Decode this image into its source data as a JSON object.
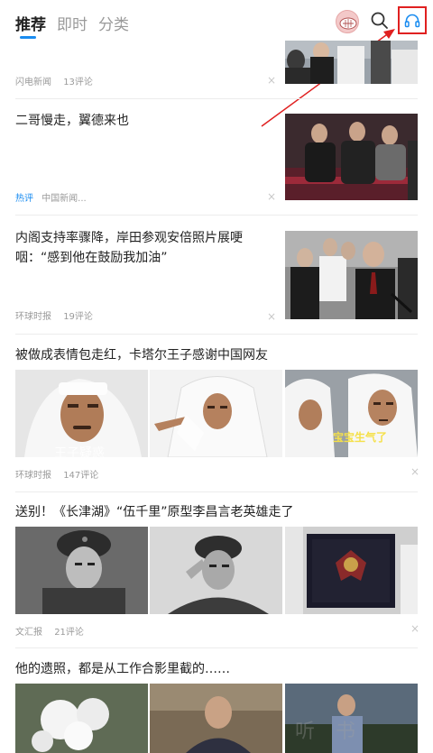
{
  "header": {
    "tabs": [
      {
        "label": "推荐",
        "active": true
      },
      {
        "label": "即时",
        "active": false
      },
      {
        "label": "分类",
        "active": false
      }
    ],
    "accent_color": "#1a8cf0",
    "icons": [
      "avatar",
      "search-icon",
      "headset-icon"
    ]
  },
  "feed": [
    {
      "source": "闪电新闻",
      "comments": "13评论"
    },
    {
      "title": "二哥慢走，翼德来也",
      "tag": "热评",
      "source": "中国新闻..."
    },
    {
      "title": "内阁支持率骤降，岸田参观安倍照片展哽咽：“感到他在鼓励我加油”",
      "source": "环球时报",
      "comments": "19评论"
    },
    {
      "title": "被做成表情包走红，卡塔尔王子感谢中国网友",
      "source": "环球时报",
      "comments": "147评论",
      "image_captions": [
        "王子疑惑",
        "宝宝生气了"
      ]
    },
    {
      "title": "送别！《长津湖》“伍千里”原型李昌言老英雄走了",
      "source": "文汇报",
      "comments": "21评论"
    },
    {
      "title": "他的遗照，都是从工作合影里截的……"
    }
  ],
  "close_glyph": "×",
  "watermark": "听 书"
}
